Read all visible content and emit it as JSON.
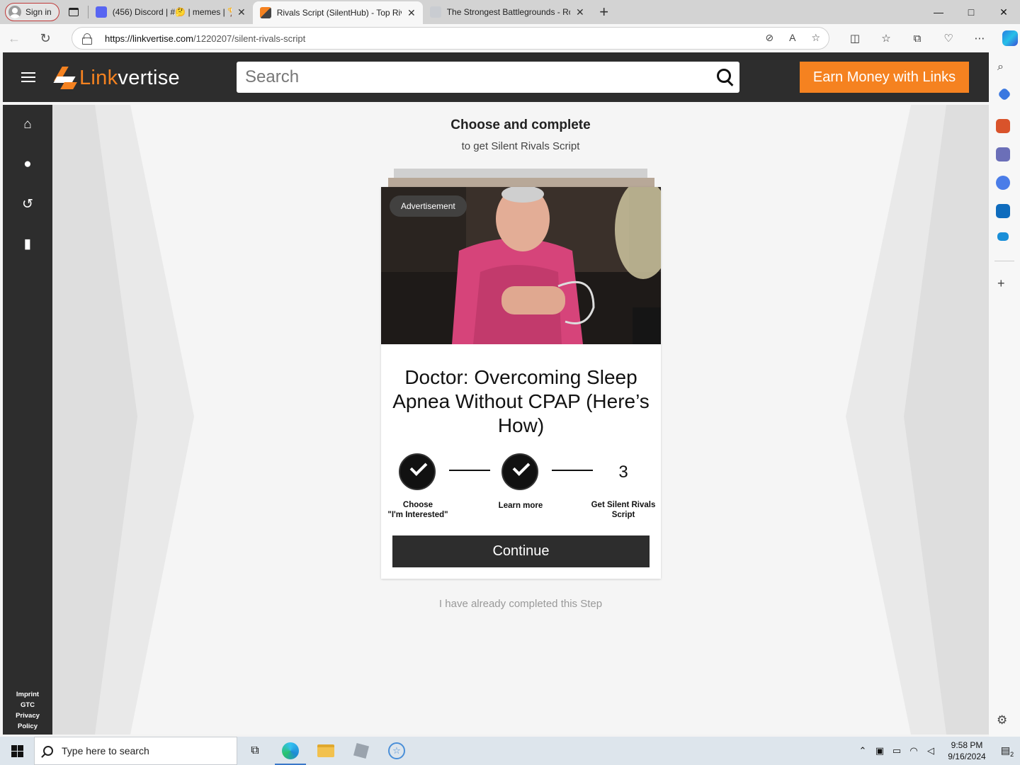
{
  "browser": {
    "signin_label": "Sign in",
    "tabs": [
      {
        "title": "(456) Discord | #🤔 | memes | 🏆",
        "active": false
      },
      {
        "title": "Rivals Script (SilentHub) - Top Rivals",
        "active": true
      },
      {
        "title": "The Strongest Battlegrounds - Roblox",
        "active": false
      }
    ],
    "url_host": "https://linkvertise.com",
    "url_path": "/1220207/silent-rivals-script",
    "window_controls": [
      "—",
      "□",
      "✕"
    ]
  },
  "site": {
    "logo_link": "Link",
    "logo_vertise": "vertise",
    "search_placeholder": "Search",
    "earn_button": "Earn Money with Links",
    "footer_links": [
      "Imprint",
      "GTC",
      "Privacy",
      "Policy"
    ]
  },
  "main": {
    "heading": "Choose and complete",
    "subheading": "to get Silent Rivals Script",
    "ad_badge": "Advertisement",
    "ad_title": "Doctor: Overcoming Sleep Apnea Without CPAP (Here’s How)",
    "steps": [
      {
        "label_line1": "Choose",
        "label_line2": "\"I'm Interested\"",
        "done": true
      },
      {
        "label_line1": "Learn more",
        "label_line2": "",
        "done": true
      },
      {
        "number": "3",
        "label_line1": "Get Silent Rivals",
        "label_line2": "Script",
        "done": false
      }
    ],
    "continue_button": "Continue",
    "already_completed": "I have already completed this Step"
  },
  "taskbar": {
    "search_placeholder": "Type here to search",
    "time": "9:58 PM",
    "date": "9/16/2024",
    "notification_count": "2"
  },
  "colors": {
    "brand_orange": "#f58220",
    "header_dark": "#2d2d2d"
  }
}
